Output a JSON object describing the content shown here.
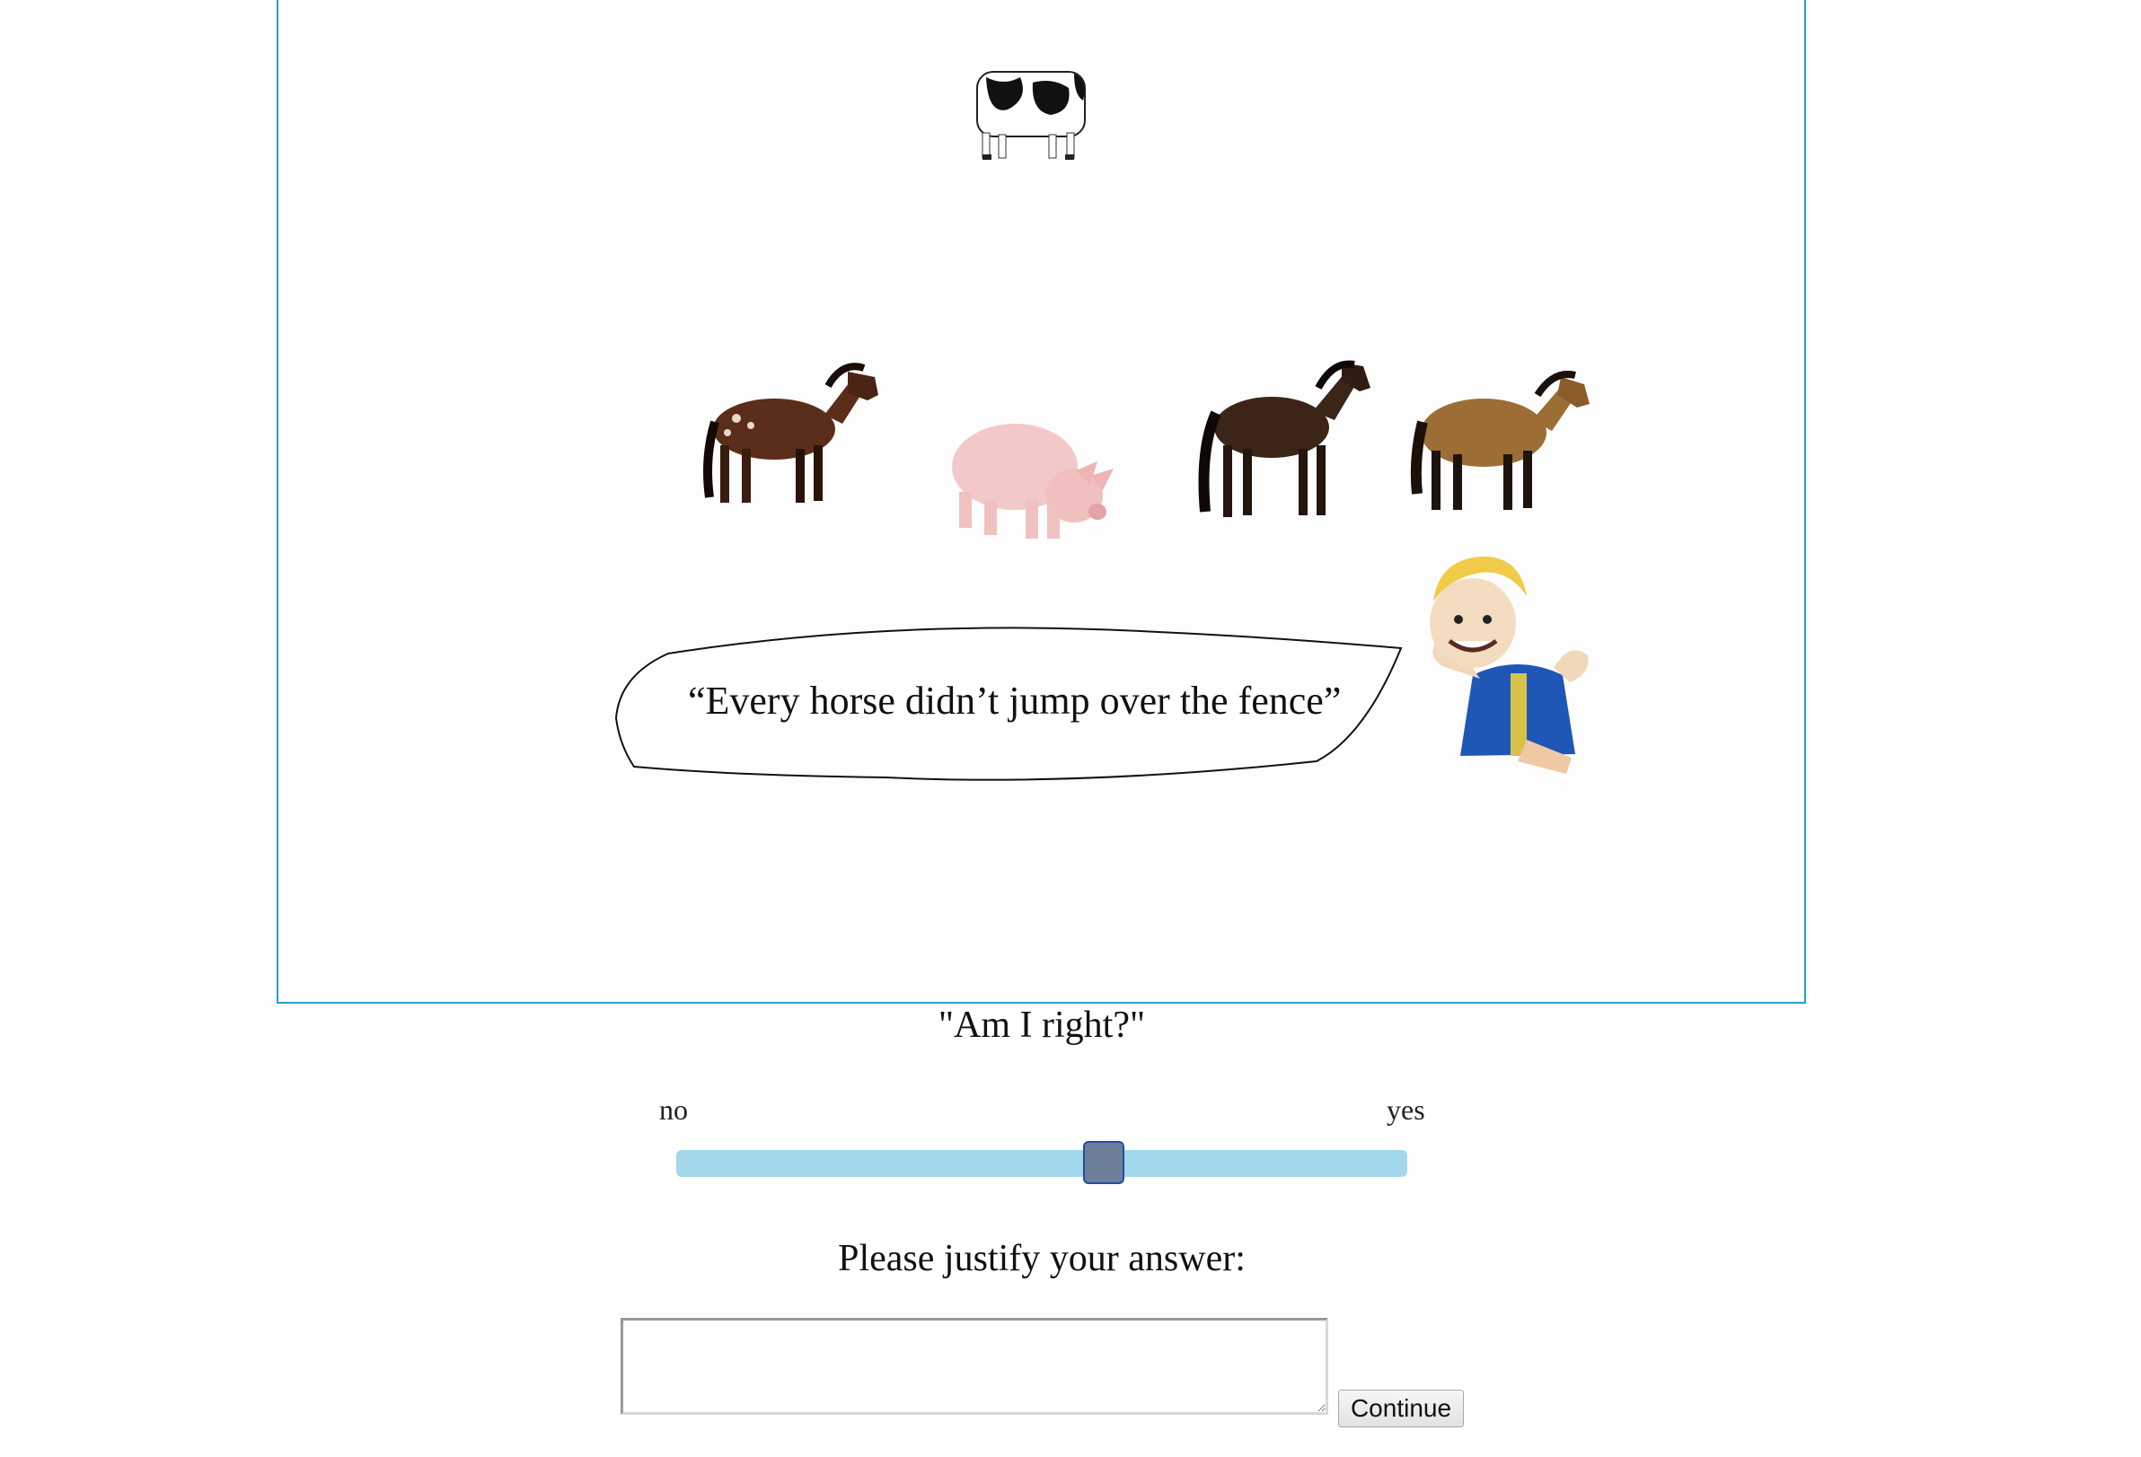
{
  "scene": {
    "animals": [
      "cow",
      "horse",
      "pig",
      "horse",
      "horse"
    ],
    "speaker": "puppet",
    "utterance": "“Every horse didn’t jump over the fence”"
  },
  "question": "\"Am I right?\"",
  "slider": {
    "min_label": "no",
    "max_label": "yes",
    "value_fraction": 0.59
  },
  "justify": {
    "label": "Please justify your answer:",
    "value": "",
    "placeholder": ""
  },
  "continue_label": "Continue",
  "colors": {
    "frame_border": "#2a9fc9",
    "slider_track": "#a3d7ec",
    "slider_thumb": "#6d7f99",
    "slider_thumb_border": "#1e4fa4"
  }
}
